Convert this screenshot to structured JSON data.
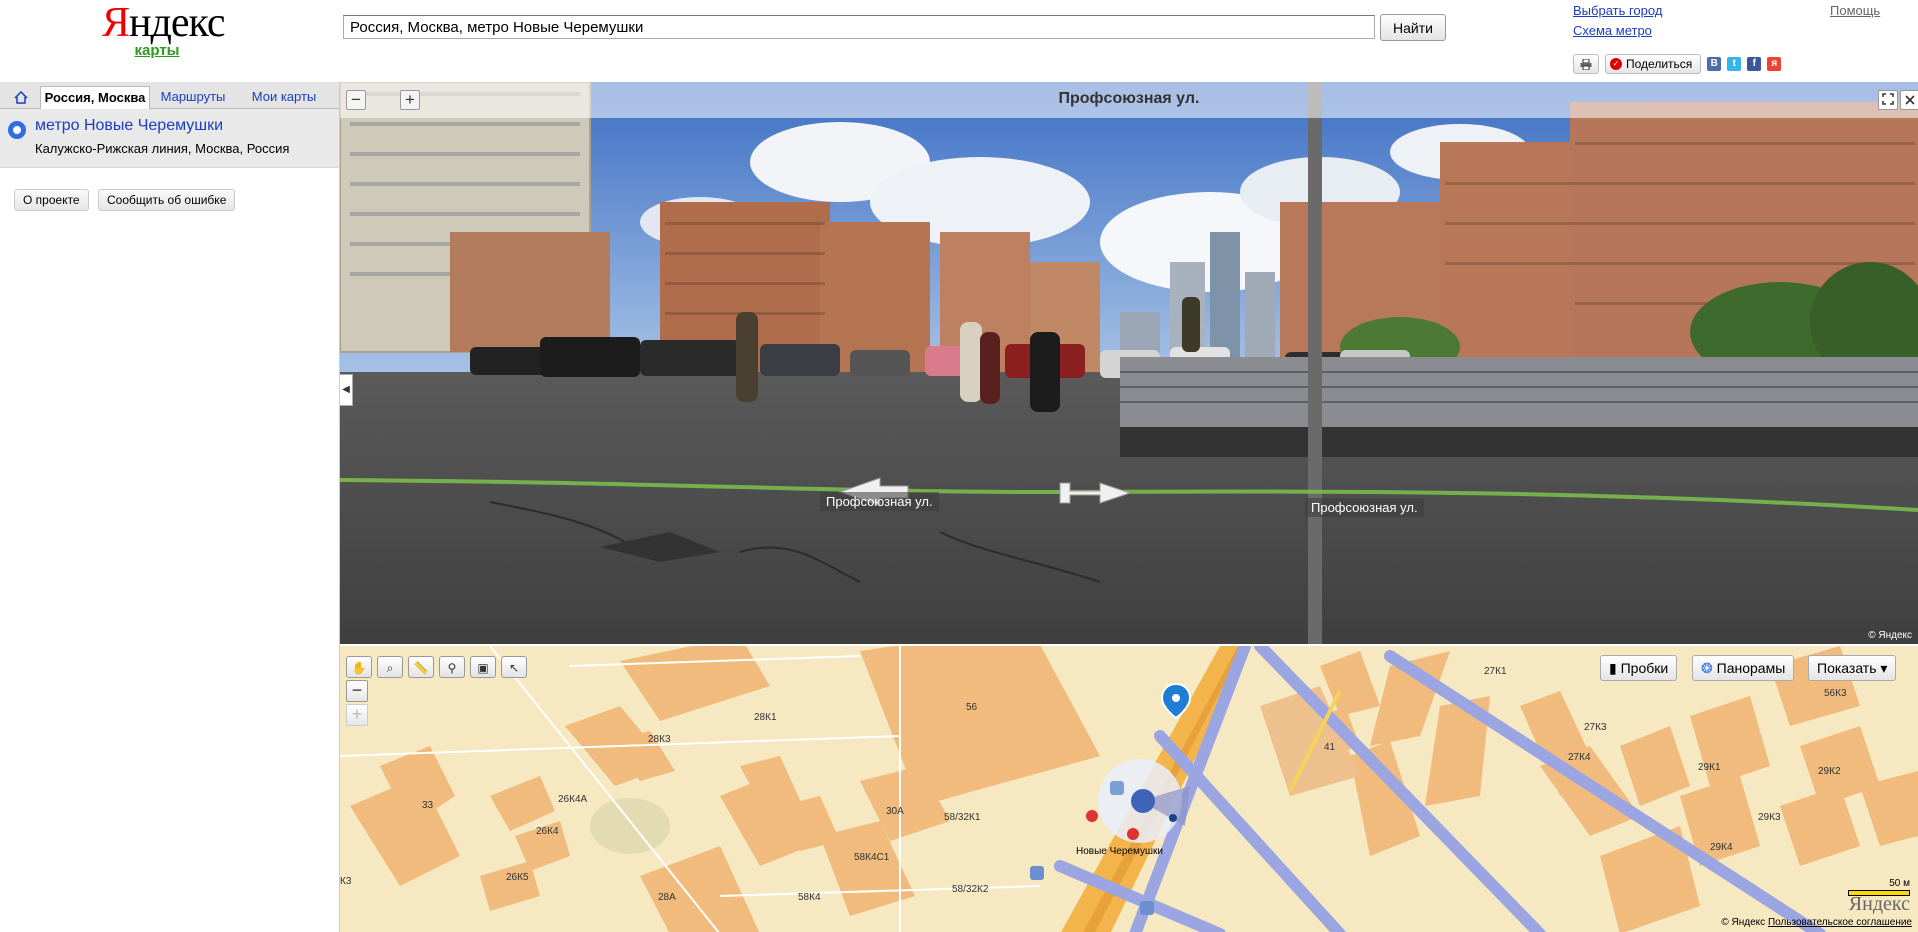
{
  "header": {
    "logo_main": "ндекс",
    "logo_y": "Я",
    "logo_sub": "карты",
    "search_value": "Россия, Москва, метро Новые Черемушки",
    "search_button": "Найти",
    "choose_city": "Выбрать город",
    "metro_scheme": "Схема метро",
    "help": "Помощь",
    "share_label": "Поделиться",
    "print_icon": "printer-icon",
    "social": [
      "В",
      "t",
      "f",
      "я"
    ]
  },
  "sidebar": {
    "tabs": {
      "home_icon": "home-icon",
      "active": "Россия, Москва",
      "routes": "Маршруты",
      "mymaps": "Мои карты"
    },
    "result": {
      "title": "метро Новые Черемушки",
      "subtitle": "Калужско-Рижская линия, Москва, Россия"
    },
    "buttons": {
      "about": "О проекте",
      "report": "Сообщить об ошибке"
    }
  },
  "panorama": {
    "title": "Профсоюзная ул.",
    "street_left": "Профсоюзная ул.",
    "street_right": "Профсоюзная ул.",
    "zoom_out": "−",
    "zoom_in": "+",
    "copyright": "© Яндекс"
  },
  "map": {
    "zoom_in": "−",
    "zoom_out": "+",
    "layers": {
      "traffic": "Пробки",
      "panoramas": "Панорамы",
      "show": "Показать ▾"
    },
    "labels": [
      "28К1",
      "28К3",
      "56",
      "27К1",
      "56К3",
      "41",
      "27К3",
      "27К4",
      "29К1",
      "29К2",
      "33",
      "26К4А",
      "26К4",
      "30А",
      "58/32К1",
      "29К3",
      "29К4",
      "58К4С1",
      "26К5",
      "28А",
      "58К4",
      "58/32К2",
      "К3"
    ],
    "metro_label": "Новые Черемушки",
    "scale_label": "50 м",
    "copyright": "© Яндекс",
    "agreement": "Пользовательское соглашение",
    "logo": "Яндекс"
  },
  "colors": {
    "link": "#1a3dc1",
    "map_bg": "#f6e8c1",
    "building": "#f0bb7d",
    "road_major": "#f4b44c",
    "road_blue": "#9aa5e2",
    "marker": "#2f6de1"
  }
}
